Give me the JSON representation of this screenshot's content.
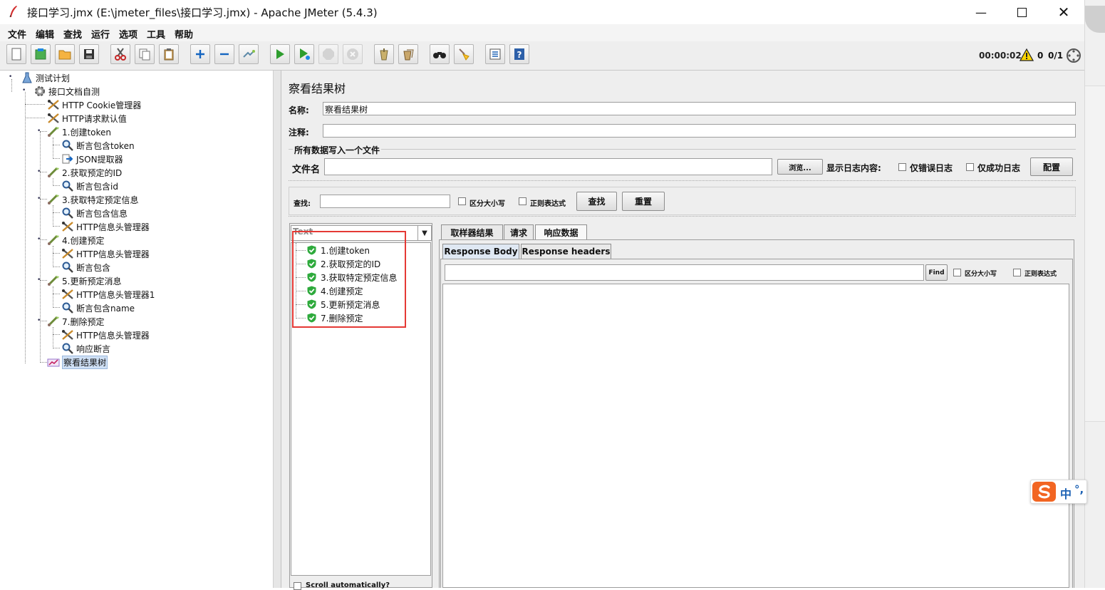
{
  "window": {
    "title": "接口学习.jmx (E:\\jmeter_files\\接口学习.jmx) - Apache JMeter (5.4.3)"
  },
  "menu": [
    "文件",
    "编辑",
    "查找",
    "运行",
    "选项",
    "工具",
    "帮助"
  ],
  "toolbar": {
    "icons": [
      "new-icon",
      "templates-icon",
      "open-icon",
      "save-icon",
      "cut-icon",
      "copy-icon",
      "paste-icon",
      "expand-icon",
      "collapse-icon",
      "toggle-icon",
      "start-icon",
      "start-no-pause-icon",
      "stop-icon",
      "shutdown-icon",
      "clear-icon",
      "clear-all-icon",
      "search-icon",
      "reset-search-icon",
      "function-helper-icon",
      "help-icon"
    ],
    "elapsed": "00:00:02",
    "warnings": "0",
    "threads": "0/1"
  },
  "tree": {
    "root": "测试计划",
    "group": "接口文档自测",
    "items": [
      {
        "label": "HTTP Cookie管理器",
        "icon": "tools-icon"
      },
      {
        "label": "HTTP请求默认值",
        "icon": "tools-icon"
      },
      {
        "label": "1.创建token",
        "icon": "sampler-icon"
      },
      {
        "label": "断言包含token",
        "icon": "magnifier-icon"
      },
      {
        "label": "JSON提取器",
        "icon": "arrow-icon"
      },
      {
        "label": "2.获取预定的ID",
        "icon": "sampler-icon"
      },
      {
        "label": "断言包含id",
        "icon": "magnifier-icon"
      },
      {
        "label": "3.获取特定预定信息",
        "icon": "sampler-icon"
      },
      {
        "label": "断言包含信息",
        "icon": "magnifier-icon"
      },
      {
        "label": "HTTP信息头管理器",
        "icon": "tools-icon"
      },
      {
        "label": "4.创建预定",
        "icon": "sampler-icon"
      },
      {
        "label": "HTTP信息头管理器",
        "icon": "tools-icon"
      },
      {
        "label": "断言包含",
        "icon": "magnifier-icon"
      },
      {
        "label": "5.更新预定消息",
        "icon": "sampler-icon"
      },
      {
        "label": "HTTP信息头管理器1",
        "icon": "tools-icon"
      },
      {
        "label": "断言包含name",
        "icon": "magnifier-icon"
      },
      {
        "label": "7.删除预定",
        "icon": "sampler-icon"
      },
      {
        "label": "HTTP信息头管理器",
        "icon": "tools-icon"
      },
      {
        "label": "响应断言",
        "icon": "magnifier-icon"
      },
      {
        "label": "察看结果树",
        "icon": "listener-icon"
      }
    ]
  },
  "panel": {
    "title": "察看结果树",
    "name_label": "名称:",
    "name_value": "察看结果树",
    "comment_label": "注释:",
    "comment_value": "",
    "write_group": "所有数据写入一个文件",
    "filename_label": "文件名",
    "filename_value": "",
    "browse": "浏览...",
    "log_label": "显示日志内容:",
    "errors_only": "仅错误日志",
    "success_only": "仅成功日志",
    "configure": "配置",
    "search_label": "查找:",
    "search_value": "",
    "case_sensitive": "区分大小写",
    "regex": "正则表达式",
    "find_btn": "查找",
    "reset_btn": "重置",
    "renderer": "Text",
    "tabs": [
      "取样器结果",
      "请求",
      "响应数据"
    ],
    "active_tab": "响应数据",
    "subtabs": [
      "Response Body",
      "Response headers"
    ],
    "find_small": "Find",
    "case_small": "区分大小写",
    "regex_small": "正则表达式",
    "scroll_auto": "Scroll automatically?",
    "results": [
      "1.创建token",
      "2.获取预定的ID",
      "3.获取特定预定信息",
      "4.创建预定",
      "5.更新预定消息",
      "7.删除预定"
    ]
  },
  "ime": {
    "label": "中",
    "punct": "°,"
  }
}
